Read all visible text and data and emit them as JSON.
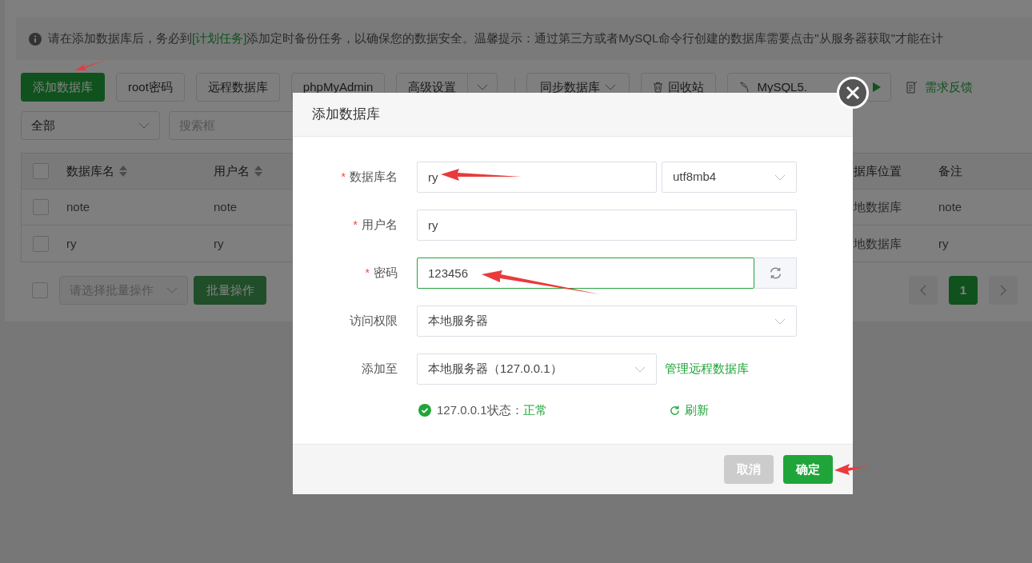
{
  "notice": {
    "before": "请在添加数据库后，务必到",
    "link": "[计划任务]",
    "after": "添加定时备份任务，以确保您的数据安全。温馨提示：通过第三方或者MySQL命令行创建的数据库需要点击\"从服务器获取\"才能在计"
  },
  "toolbar": [
    {
      "label": "添加数据库",
      "kind": "primary"
    },
    {
      "label": "root密码",
      "kind": "default"
    },
    {
      "label": "远程数据库",
      "kind": "default"
    },
    {
      "label": "phpMyAdmin",
      "kind": "default"
    },
    {
      "label": "高级设置",
      "kind": "split"
    },
    {
      "label": "同步数据库",
      "kind": "dropdown"
    },
    {
      "label": "回收站",
      "kind": "trash"
    },
    {
      "label": "MySQL5.",
      "kind": "mysql"
    },
    {
      "label": "需求反馈",
      "kind": "feedback"
    }
  ],
  "filters": {
    "category": "全部",
    "search_placeholder": "搜索框"
  },
  "table": {
    "header_checked": false,
    "columns": [
      {
        "label": "数据库名",
        "sortable": true
      },
      {
        "label": "用户名",
        "sortable": true
      },
      {
        "label": "据库位置",
        "sortable": false
      },
      {
        "label": "备注",
        "sortable": false
      }
    ],
    "rows": [
      {
        "checked": false,
        "cells": [
          "note",
          "note",
          "地数据库",
          "note"
        ]
      },
      {
        "checked": false,
        "cells": [
          "ry",
          "ry",
          "地数据库",
          "ry"
        ]
      }
    ]
  },
  "bulk": {
    "checked": false,
    "placeholder": "请选择批量操作",
    "button": "批量操作"
  },
  "pagination": {
    "pages": [
      {
        "label": "1",
        "selected": true
      }
    ]
  },
  "dialog": {
    "title": "添加数据库",
    "fields": [
      {
        "label": "数据库名",
        "required_mark": "*",
        "kind": "input_select",
        "value": "ry",
        "select": "utf8mb4"
      },
      {
        "label": "用户名",
        "required_mark": "*",
        "kind": "input",
        "value": "ry"
      },
      {
        "label": "密码",
        "required_mark": "*",
        "kind": "password",
        "value": "123456",
        "focused": true
      },
      {
        "label": "访问权限",
        "kind": "select",
        "value": "本地服务器"
      },
      {
        "label": "添加至",
        "kind": "select_link",
        "value": "本地服务器（127.0.0.1）",
        "link": "管理远程数据库"
      }
    ],
    "status": {
      "label": "127.0.0.1状态：",
      "value": "正常",
      "refresh": "刷新"
    },
    "buttons": [
      {
        "label": "取消",
        "kind": "cancel"
      },
      {
        "label": "确定",
        "kind": "confirm"
      }
    ]
  }
}
